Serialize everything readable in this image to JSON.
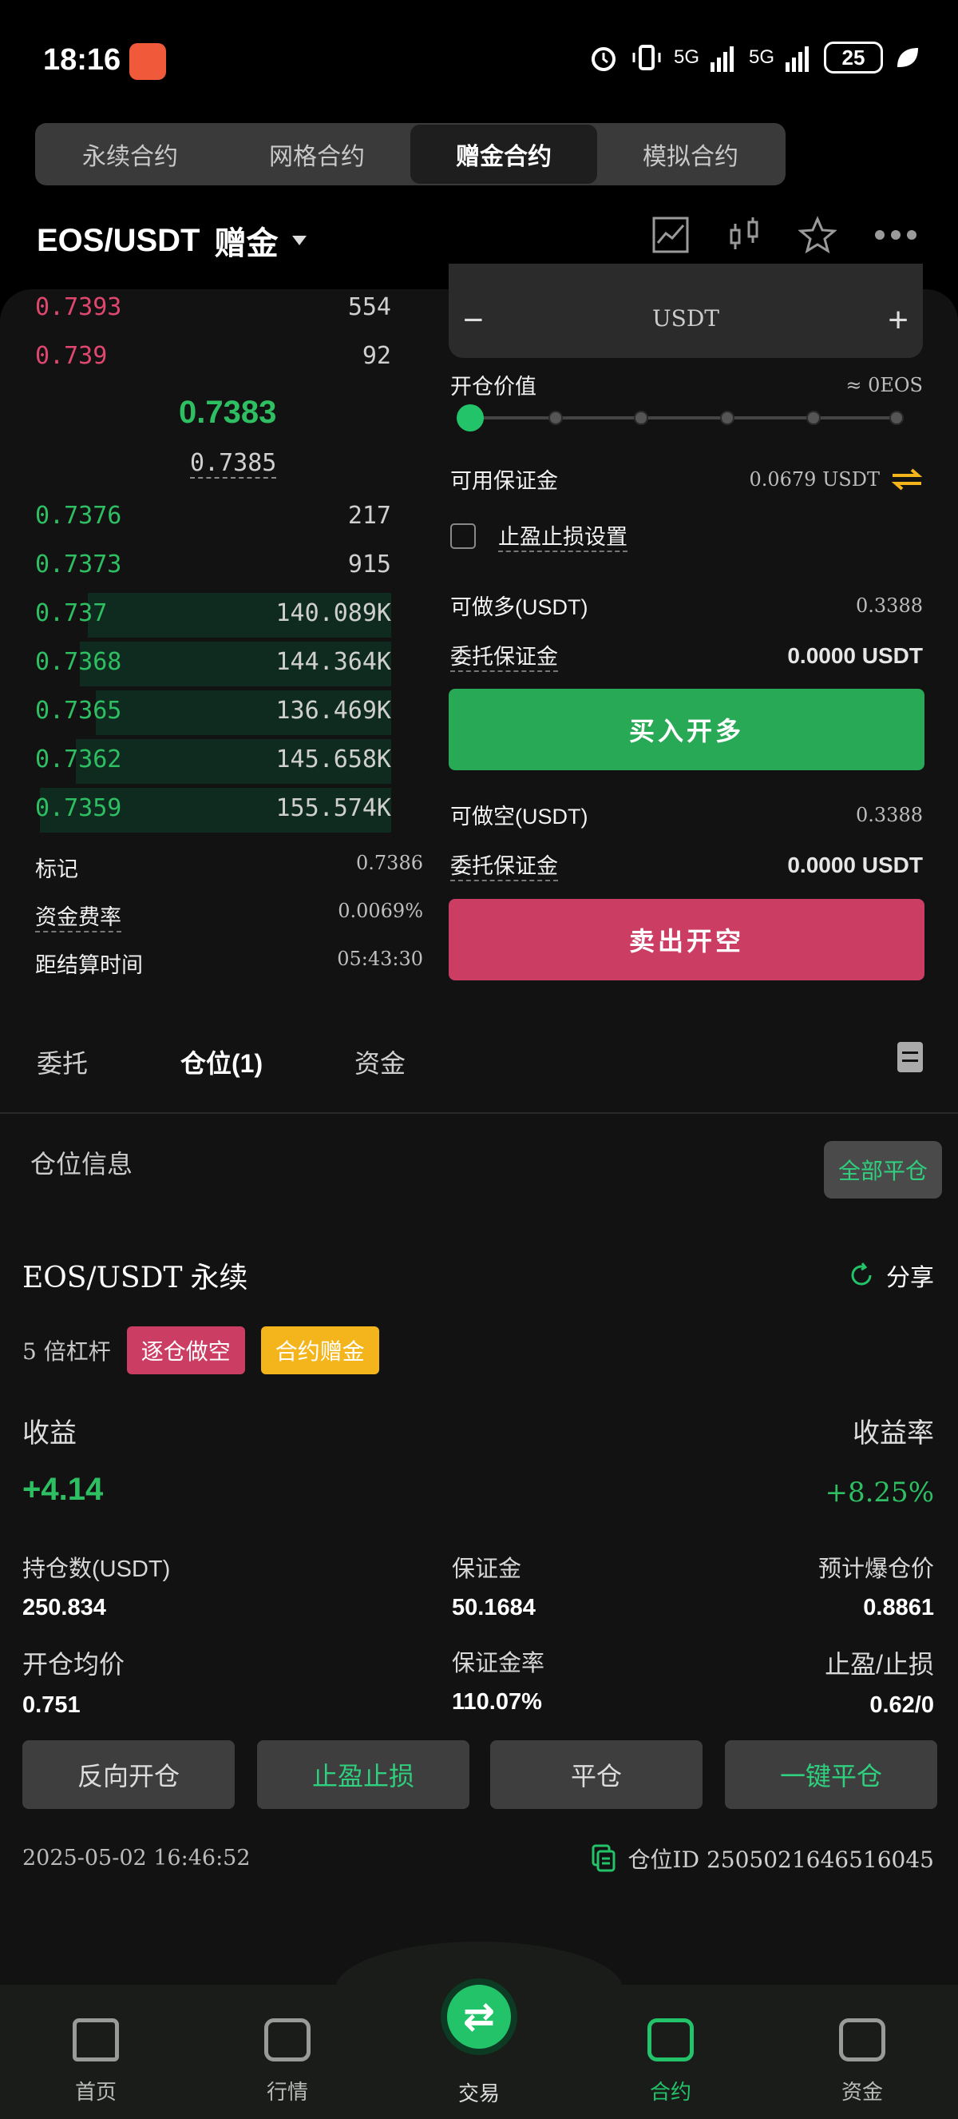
{
  "status_bar": {
    "time": "18:16",
    "signal1": "5G",
    "signal2": "5G",
    "battery": "25"
  },
  "contract_tabs": [
    {
      "label": "永续合约"
    },
    {
      "label": "网格合约"
    },
    {
      "label": "赠金合约"
    },
    {
      "label": "模拟合约"
    }
  ],
  "header": {
    "pair": "EOS/USDT",
    "pair_suffix": "赠金"
  },
  "orderbook": {
    "asks": [
      {
        "price": "0.7393",
        "qty": "554"
      },
      {
        "price": "0.739",
        "qty": "92"
      }
    ],
    "mid_price": "0.7383",
    "mark_price": "0.7385",
    "bids": [
      {
        "price": "0.7376",
        "qty": "217"
      },
      {
        "price": "0.7373",
        "qty": "915"
      },
      {
        "price": "0.737",
        "qty": "140.089K"
      },
      {
        "price": "0.7368",
        "qty": "144.364K"
      },
      {
        "price": "0.7365",
        "qty": "136.469K"
      },
      {
        "price": "0.7362",
        "qty": "145.658K"
      },
      {
        "price": "0.7359",
        "qty": "155.574K"
      }
    ]
  },
  "market_info": {
    "mark_label": "标记",
    "mark_value": "0.7386",
    "funding_label": "资金费率",
    "funding_value": "0.0069%",
    "settle_label": "距结算时间",
    "settle_value": "05:43:30"
  },
  "order_form": {
    "amount_unit": "USDT",
    "minus": "−",
    "plus": "+",
    "open_value_label": "开仓价值",
    "open_value": "≈ 0EOS",
    "slider_level": 0,
    "available_label": "可用保证金",
    "available_value": "0.0679 USDT",
    "tpsl_label": "止盈止损设置",
    "long_max_label": "可做多(USDT)",
    "long_max_value": "0.3388",
    "long_margin_label": "委托保证金",
    "long_margin_value": "0.0000 USDT",
    "buy_button": "买入开多",
    "short_max_label": "可做空(USDT)",
    "short_max_value": "0.3388",
    "short_margin_label": "委托保证金",
    "short_margin_value": "0.0000 USDT",
    "sell_button": "卖出开空"
  },
  "bottom_tabs": {
    "orders": "委托",
    "positions": "仓位(1)",
    "funds": "资金"
  },
  "positions": {
    "section_title": "仓位信息",
    "close_all": "全部平仓",
    "pair": "EOS/USDT",
    "pair_type": "永续",
    "share": "分享",
    "leverage": "5 倍杠杆",
    "tag_mode": "逐仓做空",
    "tag_bonus": "合约赠金",
    "pnl_label": "收益",
    "pnl_value": "+4.14",
    "roe_label": "收益率",
    "roe_value": "+8.25%",
    "size_label": "持仓数(USDT)",
    "size_value": "250.834",
    "margin_label": "保证金",
    "margin_value": "50.1684",
    "liq_label": "预计爆仓价",
    "liq_value": "0.8861",
    "entry_label": "开仓均价",
    "entry_value": "0.751",
    "margin_ratio_label": "保证金率",
    "margin_ratio_value": "110.07%",
    "tpsl_label": "止盈/止损",
    "tpsl_value": "0.62/0",
    "btn_reverse": "反向开仓",
    "btn_tpsl": "止盈止损",
    "btn_close": "平仓",
    "btn_quick_close": "一键平仓",
    "time": "2025-05-02 16:46:52",
    "position_id": "仓位ID 2505021646516045"
  },
  "nav": [
    {
      "label": "首页",
      "icon": "home-icon"
    },
    {
      "label": "行情",
      "icon": "market-icon"
    },
    {
      "label": "交易",
      "icon": "swap-icon"
    },
    {
      "label": "合约",
      "icon": "contract-icon"
    },
    {
      "label": "资金",
      "icon": "wallet-icon"
    }
  ],
  "colors": {
    "green": "#2fbf63",
    "red": "#cc3d63",
    "yellow": "#f3b51b",
    "accent": "#23c36a"
  }
}
